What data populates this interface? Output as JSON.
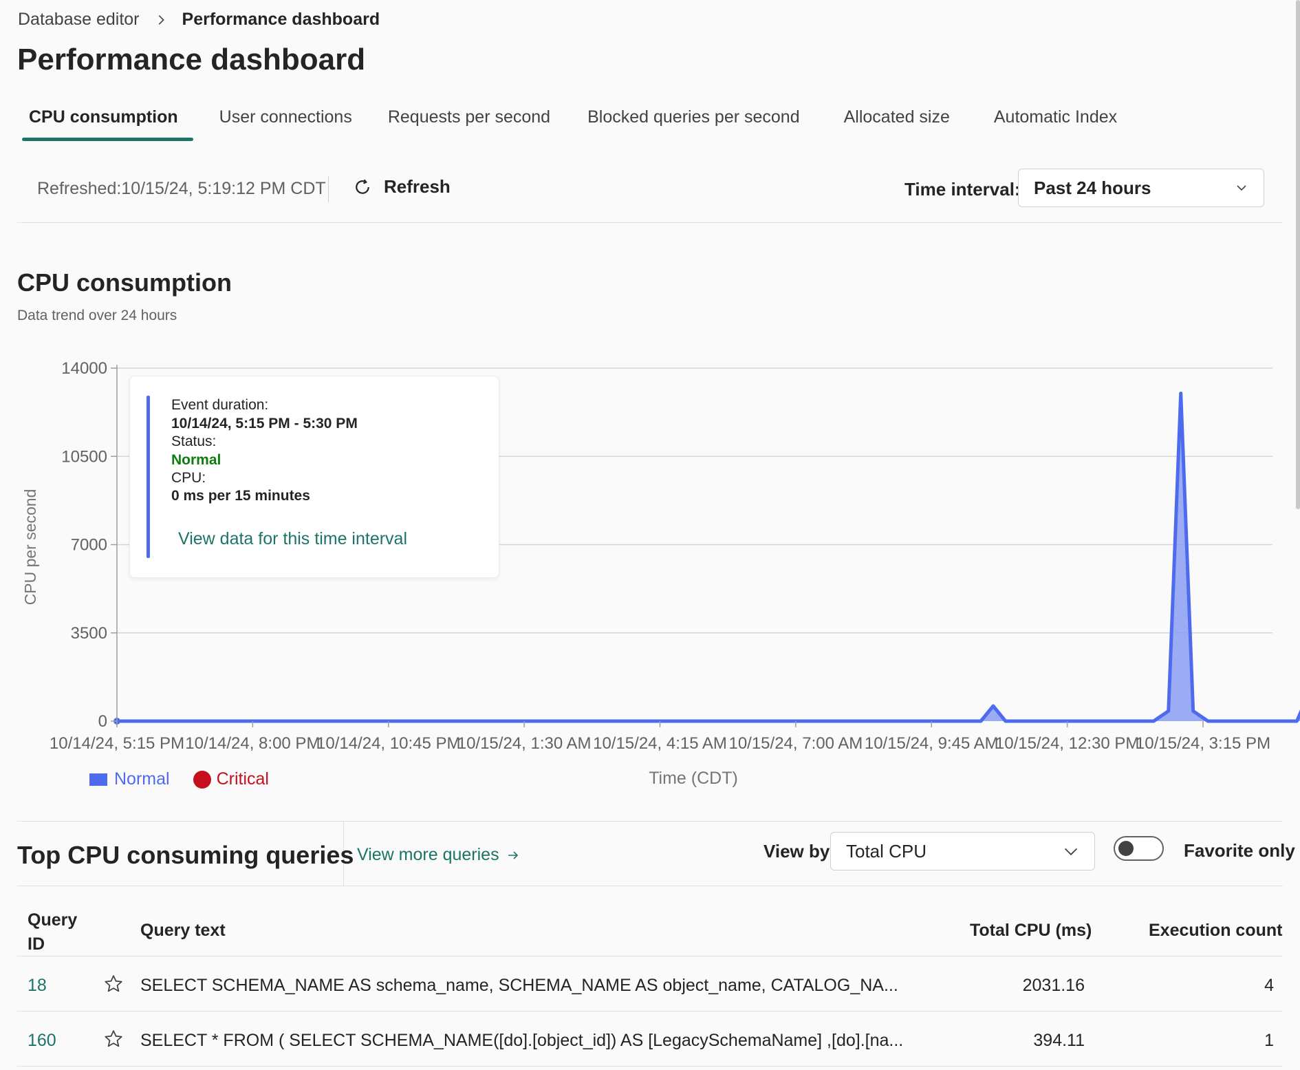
{
  "breadcrumb": {
    "parent": "Database editor",
    "current": "Performance dashboard"
  },
  "page_title": "Performance dashboard",
  "tabs": [
    {
      "label": "CPU consumption",
      "active": true
    },
    {
      "label": "User connections",
      "active": false
    },
    {
      "label": "Requests per second",
      "active": false
    },
    {
      "label": "Blocked queries per second",
      "active": false
    },
    {
      "label": "Allocated size",
      "active": false
    },
    {
      "label": "Automatic Index",
      "active": false
    }
  ],
  "toolbar": {
    "refreshed": "Refreshed:10/15/24, 5:19:12 PM CDT",
    "refresh_label": "Refresh",
    "interval_label": "Time interval:",
    "interval_value": "Past 24 hours"
  },
  "section": {
    "title": "CPU consumption",
    "subtitle": "Data trend over 24 hours"
  },
  "tooltip": {
    "duration_label": "Event duration:",
    "duration_value": "10/14/24, 5:15 PM - 5:30 PM",
    "status_label": "Status:",
    "status_value": "Normal",
    "cpu_label": "CPU:",
    "cpu_value": "0 ms per 15 minutes",
    "link": "View data for this time interval"
  },
  "legend": {
    "normal": "Normal",
    "critical": "Critical"
  },
  "colors": {
    "accent": "#1b7567",
    "normal": "#4f6bed",
    "critical": "#c50f1f",
    "status_normal": "#107c10"
  },
  "chart_data": {
    "type": "area",
    "ylabel": "CPU per second",
    "xlabel": "Time (CDT)",
    "ylim": [
      0,
      14000
    ],
    "yticks": [
      0,
      3500,
      7000,
      10500,
      14000
    ],
    "xlim": [
      0,
      24
    ],
    "xticks": [
      {
        "x": 0,
        "label": "10/14/24, 5:15 PM"
      },
      {
        "x": 2.75,
        "label": "10/14/24, 8:00 PM"
      },
      {
        "x": 5.5,
        "label": "10/14/24, 10:45 PM"
      },
      {
        "x": 8.25,
        "label": "10/15/24, 1:30 AM"
      },
      {
        "x": 11,
        "label": "10/15/24, 4:15 AM"
      },
      {
        "x": 13.75,
        "label": "10/15/24, 7:00 AM"
      },
      {
        "x": 16.5,
        "label": "10/15/24, 9:45 AM"
      },
      {
        "x": 19.25,
        "label": "10/15/24, 12:30 PM"
      },
      {
        "x": 22,
        "label": "10/15/24, 3:15 PM"
      }
    ],
    "grid": true,
    "series": [
      {
        "name": "Normal",
        "points": [
          [
            0,
            0
          ],
          [
            17.5,
            0
          ],
          [
            17.75,
            600
          ],
          [
            18.0,
            0
          ],
          [
            21.0,
            0
          ],
          [
            21.3,
            400
          ],
          [
            21.55,
            13000
          ],
          [
            21.8,
            400
          ],
          [
            22.1,
            0
          ],
          [
            23.9,
            0
          ],
          [
            24.1,
            900
          ],
          [
            24.35,
            0
          ],
          [
            24.7,
            0
          ]
        ]
      }
    ],
    "highlight_point": [
      0,
      0
    ]
  },
  "queries": {
    "title": "Top CPU consuming queries",
    "more_link": "View more queries",
    "viewby_label": "View by:",
    "viewby_value": "Total CPU",
    "favorite_label": "Favorite only",
    "columns": {
      "id": "Query ID",
      "text": "Query text",
      "total_cpu": "Total CPU (ms)",
      "exec_count": "Execution count"
    },
    "rows": [
      {
        "id": "18",
        "text": "SELECT SCHEMA_NAME AS schema_name, SCHEMA_NAME AS object_name, CATALOG_NA...",
        "total_cpu": "2031.16",
        "exec_count": "4"
      },
      {
        "id": "160",
        "text": "SELECT * FROM ( SELECT SCHEMA_NAME([do].[object_id]) AS [LegacySchemaName] ,[do].[na...",
        "total_cpu": "394.11",
        "exec_count": "1"
      }
    ]
  }
}
